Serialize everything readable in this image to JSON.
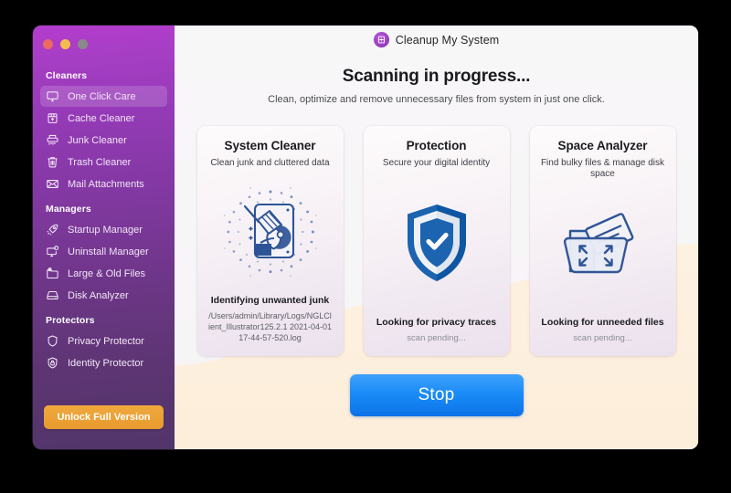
{
  "window": {
    "traffic_lights": [
      {
        "name": "close",
        "color": "#ec6a5f"
      },
      {
        "name": "minimize",
        "color": "#f5bd4f"
      },
      {
        "name": "zoom",
        "color": "#8a8a8a"
      }
    ]
  },
  "sidebar": {
    "groups": [
      {
        "title": "Cleaners",
        "items": [
          {
            "label": "One Click Care",
            "icon": "monitor-icon",
            "active": true
          },
          {
            "label": "Cache Cleaner",
            "icon": "cache-box-icon",
            "active": false
          },
          {
            "label": "Junk Cleaner",
            "icon": "shredder-icon",
            "active": false
          },
          {
            "label": "Trash Cleaner",
            "icon": "trash-icon",
            "active": false
          },
          {
            "label": "Mail Attachments",
            "icon": "envelope-icon",
            "active": false
          }
        ]
      },
      {
        "title": "Managers",
        "items": [
          {
            "label": "Startup Manager",
            "icon": "rocket-icon",
            "active": false
          },
          {
            "label": "Uninstall Manager",
            "icon": "uninstall-monitor-icon",
            "active": false
          },
          {
            "label": "Large & Old Files",
            "icon": "folder-clock-icon",
            "active": false
          },
          {
            "label": "Disk Analyzer",
            "icon": "disk-icon",
            "active": false
          }
        ]
      },
      {
        "title": "Protectors",
        "items": [
          {
            "label": "Privacy Protector",
            "icon": "shield-icon",
            "active": false
          },
          {
            "label": "Identity Protector",
            "icon": "lock-icon",
            "active": false
          }
        ]
      }
    ],
    "unlock_button": "Unlock Full Version",
    "accent_colors": {
      "gradient_top": "#b43cce",
      "gradient_bottom": "#52356a",
      "unlock_button": "#eda33a"
    }
  },
  "header": {
    "app_title": "Cleanup My System",
    "logo_icon": "cleanup-logo-icon",
    "heading": "Scanning in progress...",
    "subheading": "Clean, optimize and remove unnecessary files from system in just one click."
  },
  "cards": [
    {
      "title": "System Cleaner",
      "subtitle": "Clean junk and cluttered data",
      "icon": "broom-disk-icon",
      "status": "Identifying unwanted junk",
      "detail": "/Users/admin/Library/Logs/NGLClient_Illustrator125.2.1 2021-04-01 17-44-57-520.log",
      "pending": ""
    },
    {
      "title": "Protection",
      "subtitle": "Secure your digital identity",
      "icon": "shield-check-icon",
      "status": "Looking for privacy traces",
      "detail": "",
      "pending": "scan pending..."
    },
    {
      "title": "Space Analyzer",
      "subtitle": "Find bulky files & manage disk space",
      "icon": "folder-expand-icon",
      "status": "Looking for unneeded files",
      "detail": "",
      "pending": "scan pending..."
    }
  ],
  "actions": {
    "stop_button": "Stop",
    "stop_button_color": "#1b8cf7"
  }
}
